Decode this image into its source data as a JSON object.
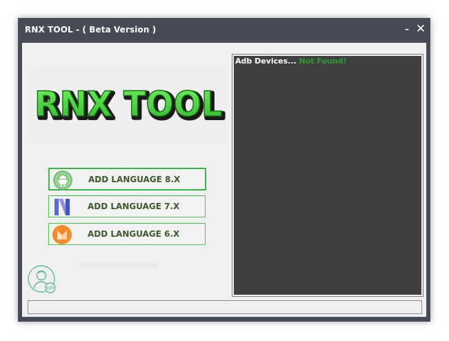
{
  "window": {
    "title": "RNX TOOL - ( Beta Version )",
    "minimize_glyph": "–",
    "close_glyph": "✕"
  },
  "logo": {
    "text": "RNX TOOL",
    "color": "#43d43a"
  },
  "buttons": [
    {
      "label": "ADD LANGUAGE 8.X",
      "icon": "android-oreo-icon"
    },
    {
      "label": "ADD LANGUAGE 7.X",
      "icon": "android-nougat-icon"
    },
    {
      "label": "ADD LANGUAGE 6.X",
      "icon": "android-marshmallow-icon"
    }
  ],
  "console": {
    "label": "Adb Devices...",
    "status": "Not Found!",
    "status_color": "#2e9b2e",
    "background": "#404040"
  },
  "colors": {
    "title_bar": "#474b55",
    "client": "#f0f0f0",
    "button_border": "#4fc24f",
    "button_text": "#3e5a2a"
  }
}
